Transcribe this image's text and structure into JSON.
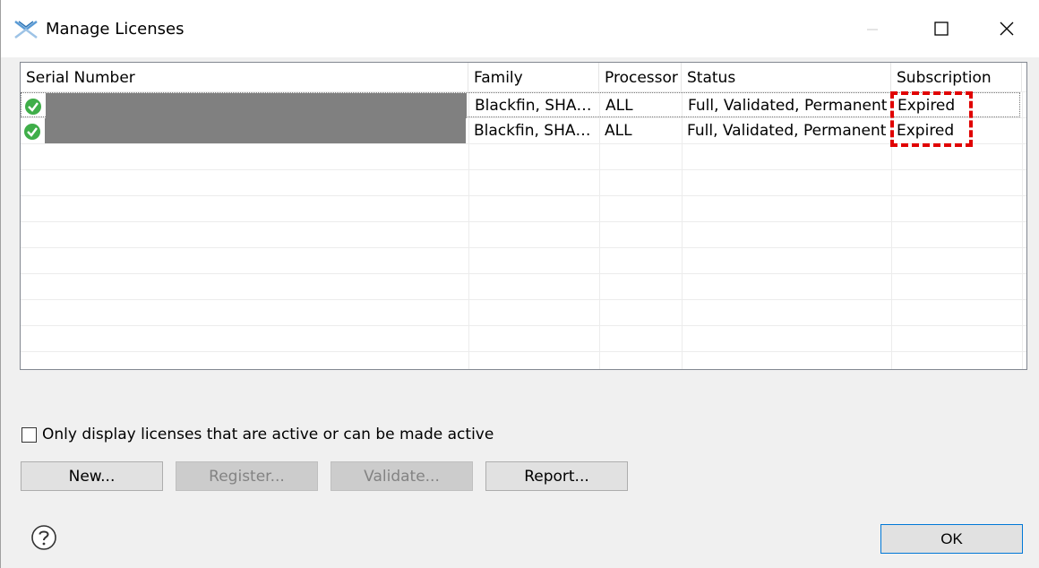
{
  "window": {
    "title": "Manage Licenses",
    "minimize_icon": "minimize-icon",
    "maximize_icon": "maximize-icon",
    "close_icon": "close-icon"
  },
  "table": {
    "columns": [
      "Serial Number",
      "Family",
      "Processor",
      "Status",
      "Subscription"
    ],
    "rows": [
      {
        "status_icon": "check-circle-icon",
        "serial_number": "",
        "family": "Blackfin, SHA…",
        "processor": "ALL",
        "status": "Full, Validated, Permanent",
        "subscription": "Expired"
      },
      {
        "status_icon": "check-circle-icon",
        "serial_number": "",
        "family": "Blackfin, SHA…",
        "processor": "ALL",
        "status": "Full, Validated, Permanent",
        "subscription": "Expired"
      }
    ],
    "highlight_color": "#e00000"
  },
  "filter": {
    "label": "Only display licenses that are active or can be made active",
    "checked": false
  },
  "buttons": {
    "new": "New...",
    "register": "Register...",
    "validate": "Validate...",
    "report": "Report...",
    "ok": "OK"
  },
  "help_icon": "help-icon"
}
